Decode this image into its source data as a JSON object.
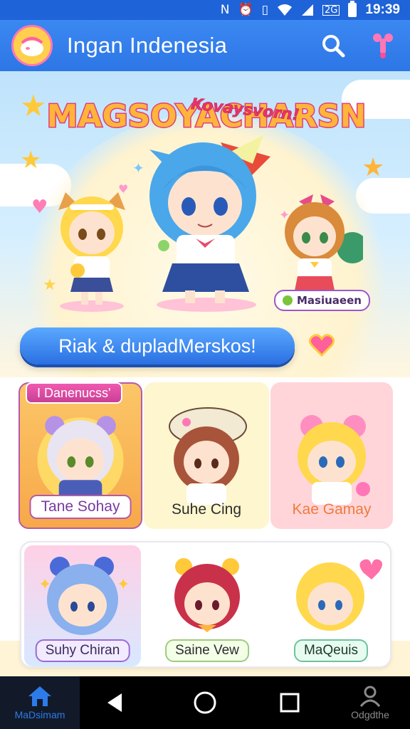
{
  "status_bar": {
    "icons": [
      "nfc-icon",
      "alarm-icon",
      "vibrate-icon",
      "wifi-icon",
      "signal-icon",
      "battery-icon"
    ],
    "nfc_glyph": "N",
    "network_label": "2G",
    "time": "19:39"
  },
  "app_bar": {
    "title": "Ingan Indenesia",
    "logo_icon": "app-logo-icon",
    "search_icon": "search-icon",
    "profile_icon": "pin-avatar-icon"
  },
  "hero": {
    "title": "MAGSOYACHARSN",
    "subtitle": "Kovaysvorn!",
    "badge": "Masiuaeen",
    "colors": {
      "sky": "#bfe3fb",
      "glow": "#fff3cf"
    }
  },
  "cta": {
    "label": "Riak & dupladMerskos!",
    "heart_icon": "heart-icon"
  },
  "section1": {
    "tag": "I Danenucss'",
    "cards": [
      {
        "label": "Tane Sohay",
        "bg": "#f8b860",
        "label_color": "#7a3aa0"
      },
      {
        "label": "Suhe Cing",
        "bg": "#fdf6cf",
        "label_color": "#2d2d2d"
      },
      {
        "label": "Kae Gamay",
        "bg": "#ffd5da",
        "label_color": "#f07b3a"
      }
    ]
  },
  "section2": {
    "tiles": [
      {
        "label": "Suhy Chiran",
        "border": "#9b6ad6"
      },
      {
        "label": "Saine Vew",
        "border": "#9ccc7e"
      },
      {
        "label": "MaQeuis",
        "border": "#6cc49a"
      }
    ]
  },
  "bottom_nav": {
    "home_label": "MaDsimam",
    "profile_label": "Odgdthe",
    "home_icon": "home-icon",
    "back_icon": "back-icon",
    "home_circle_icon": "system-home-icon",
    "recents_icon": "recents-icon",
    "profile_icon": "profile-icon"
  }
}
